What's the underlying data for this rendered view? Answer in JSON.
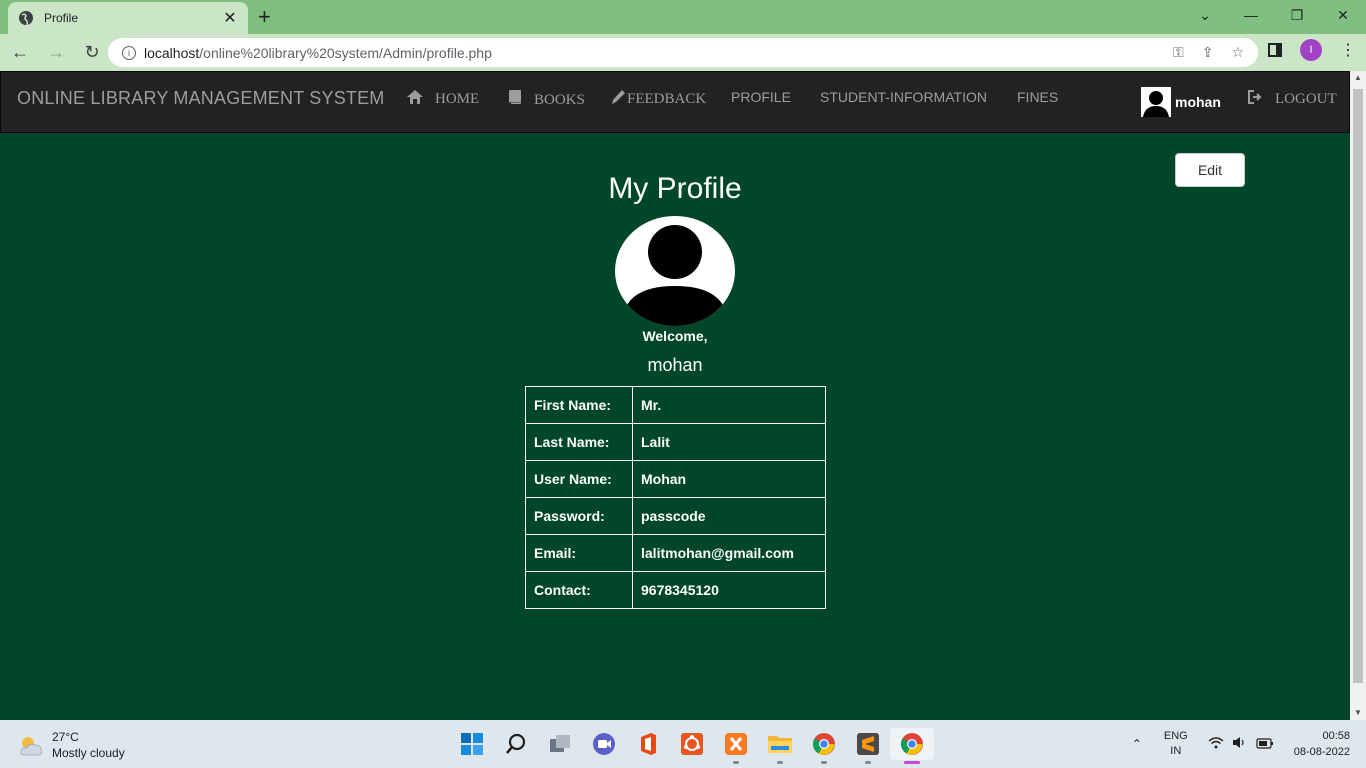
{
  "browser": {
    "tab_title": "Profile",
    "url_host": "localhost",
    "url_path": "/online%20library%20system/Admin/profile.php",
    "profile_initial": "I"
  },
  "navbar": {
    "brand": "ONLINE LIBRARY MANAGEMENT SYSTEM",
    "links": {
      "home": "HOME",
      "books": "BOOKS",
      "feedback": "FEEDBACK",
      "profile": "PROFILE",
      "student_information": "STUDENT-INFORMATION",
      "fines": "FINES",
      "logout": "LOGOUT"
    },
    "user": "mohan"
  },
  "main": {
    "edit_label": "Edit",
    "title": "My Profile",
    "welcome": "Welcome,",
    "username": "mohan",
    "details": [
      {
        "label": "First Name:",
        "value": "Mr."
      },
      {
        "label": "Last Name:",
        "value": "Lalit"
      },
      {
        "label": "User Name:",
        "value": "Mohan"
      },
      {
        "label": "Password:",
        "value": "passcode"
      },
      {
        "label": "Email:",
        "value": "lalitmohan@gmail.com"
      },
      {
        "label": "Contact:",
        "value": "9678345120"
      }
    ]
  },
  "taskbar": {
    "weather_temp": "27°C",
    "weather_desc": "Mostly cloudy",
    "lang_top": "ENG",
    "lang_bottom": "IN",
    "time": "00:58",
    "date": "08-08-2022"
  },
  "colors": {
    "page_bg": "#00472a",
    "navbar_bg": "#222222",
    "browser_frame": "#7fbf7f"
  }
}
